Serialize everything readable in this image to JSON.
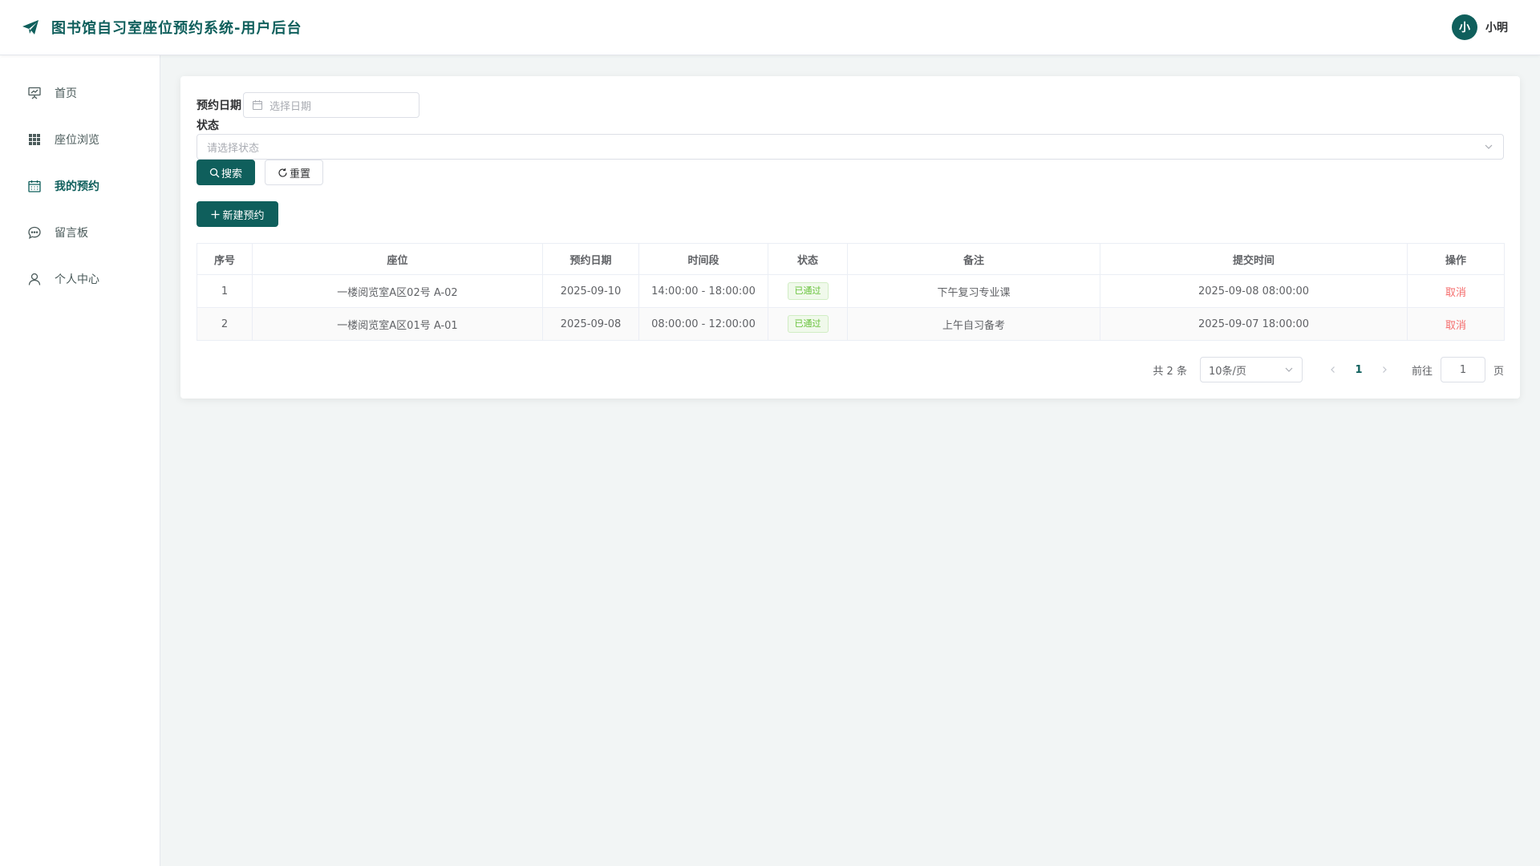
{
  "app": {
    "title": "图书馆自习室座位预约系统-用户后台",
    "brand_color": "#0f5f5c"
  },
  "user": {
    "avatar_text": "小",
    "name": "小明"
  },
  "sidebar": {
    "items": [
      {
        "label": "首页",
        "icon": "presentation-icon",
        "active": false
      },
      {
        "label": "座位浏览",
        "icon": "grid-icon",
        "active": false
      },
      {
        "label": "我的预约",
        "icon": "calendar-icon",
        "active": true
      },
      {
        "label": "留言板",
        "icon": "chat-bubble-icon",
        "active": false
      },
      {
        "label": "个人中心",
        "icon": "user-icon",
        "active": false
      }
    ]
  },
  "filters": {
    "date_label": "预约日期",
    "date_placeholder": "选择日期",
    "status_label": "状态",
    "status_placeholder": "请选择状态",
    "search_label": "搜索",
    "reset_label": "重置"
  },
  "actions": {
    "new_label": "新建预约"
  },
  "table": {
    "headers": [
      "序号",
      "座位",
      "预约日期",
      "时间段",
      "状态",
      "备注",
      "提交时间",
      "操作"
    ],
    "rows": [
      {
        "index": "1",
        "seat": "一楼阅览室A区02号 A-02",
        "date": "2025-09-10",
        "time": "14:00:00 - 18:00:00",
        "status": "已通过",
        "note": "下午复习专业课",
        "submitted": "2025-09-08 08:00:00",
        "action": "取消"
      },
      {
        "index": "2",
        "seat": "一楼阅览室A区01号 A-01",
        "date": "2025-09-08",
        "time": "08:00:00 - 12:00:00",
        "status": "已通过",
        "note": "上午自习备考",
        "submitted": "2025-09-07 18:00:00",
        "action": "取消"
      }
    ],
    "status_color": "#67c23a",
    "cancel_color": "#f56c6c"
  },
  "pagination": {
    "total_text": "共 2 条",
    "page_size": "10条/页",
    "current_page": "1",
    "goto_label": "前往",
    "goto_value": "1",
    "goto_suffix": "页"
  }
}
